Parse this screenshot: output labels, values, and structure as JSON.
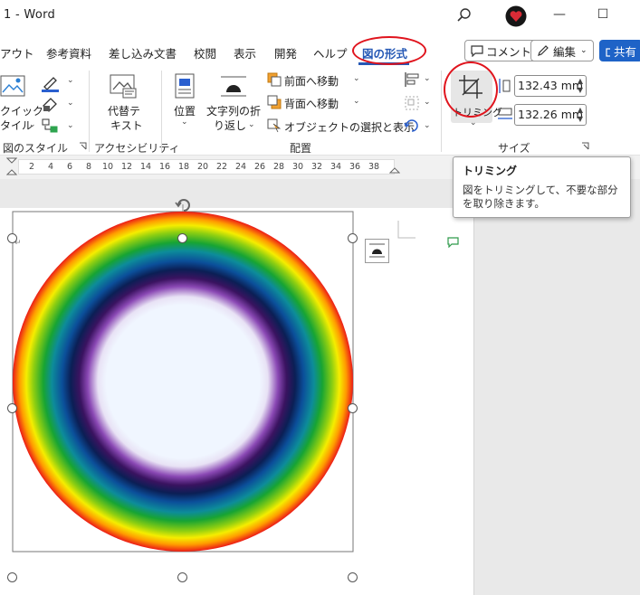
{
  "titlebar": {
    "title": "1  -  Word",
    "search_icon": "search-icon",
    "minimize": "—",
    "maximize": "☐"
  },
  "tabs": [
    {
      "label": "アウト"
    },
    {
      "label": "参考資料"
    },
    {
      "label": "差し込み文書"
    },
    {
      "label": "校閲"
    },
    {
      "label": "表示"
    },
    {
      "label": "開発"
    },
    {
      "label": "ヘルプ"
    },
    {
      "label": "図の形式",
      "active": true
    }
  ],
  "topright": {
    "comment": "コメント",
    "edit": "編集",
    "share": "共有"
  },
  "ribbon": {
    "quick_style": "クイック",
    "quick_style2": "タイル",
    "alt_text": "代替テ",
    "alt_text2": "キスト",
    "position": "位置",
    "wrap_text": "文字列の折",
    "wrap_text2": "り返し",
    "bring_forward": "前面へ移動",
    "send_backward": "背面へ移動",
    "selection_pane": "オブジェクトの選択と表示",
    "crop": "トリミング",
    "height_value": "132.43 mm",
    "width_value": "132.26 mm",
    "groups": {
      "picture_styles": "図のスタイル",
      "accessibility": "アクセシビリティ",
      "arrange": "配置",
      "size": "サイズ"
    }
  },
  "ruler": {
    "ticks": [
      "2",
      "4",
      "6",
      "8",
      "10",
      "12",
      "14",
      "16",
      "18",
      "20",
      "22",
      "24",
      "26",
      "28",
      "30",
      "32",
      "34",
      "36",
      "38"
    ]
  },
  "tooltip": {
    "title": "トリミング",
    "description": "図をトリミングして、不要な部分を取り除きます。"
  },
  "colors": {
    "accent": "#2558b5",
    "highlight": "#e0141d",
    "share_bg": "#1e63c7"
  }
}
